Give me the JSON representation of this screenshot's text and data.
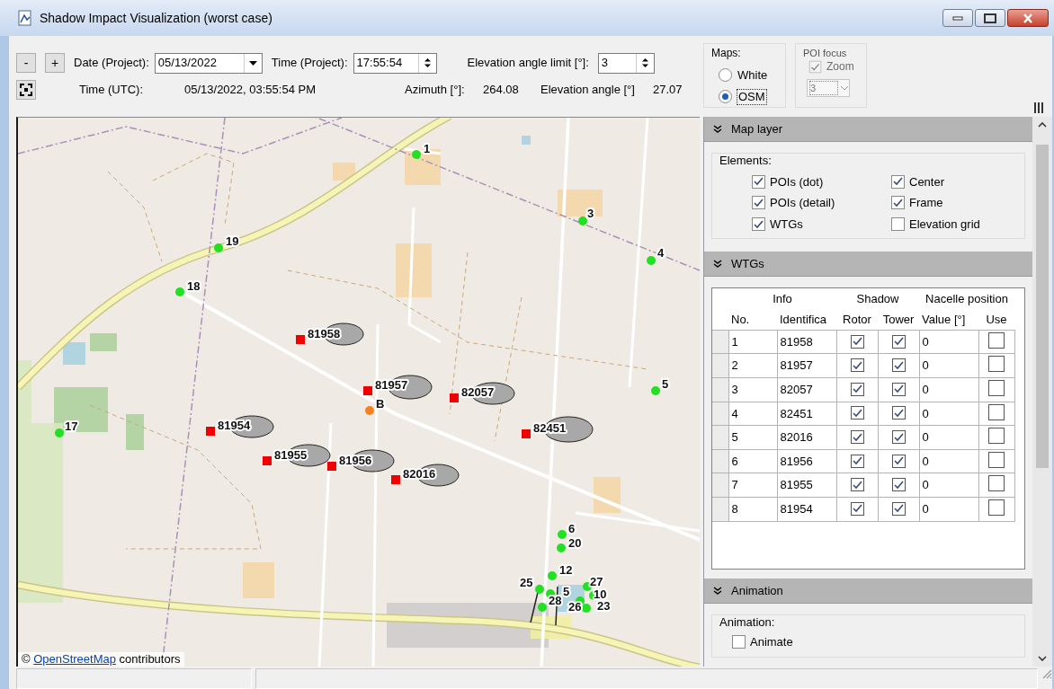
{
  "window": {
    "title": "Shadow Impact Visualization (worst case)"
  },
  "toolbar": {
    "zoom_out": "-",
    "zoom_in": "+",
    "date_label": "Date (Project):",
    "date_value": "05/13/2022",
    "time_label": "Time (Project):",
    "time_value": "17:55:54",
    "elevation_limit_label": "Elevation angle limit [°]:",
    "elevation_limit_value": "3",
    "utc_label": "Time (UTC):",
    "utc_value": "05/13/2022, 03:55:54 PM",
    "azimuth_label": "Azimuth [°]:",
    "azimuth_value": "264.08",
    "elevation_angle_label": "Elevation angle [°]",
    "elevation_angle_value": "27.07",
    "maps": {
      "legend": "Maps:",
      "options": [
        {
          "label": "White",
          "selected": false
        },
        {
          "label": "OSM",
          "selected": true
        }
      ]
    },
    "poi_focus": {
      "legend": "POI focus",
      "zoom": {
        "label": "Zoom",
        "checked": true,
        "disabled": true
      },
      "select_value": "3"
    }
  },
  "map": {
    "pois": [
      {
        "label": "1"
      },
      {
        "label": "3"
      },
      {
        "label": "19"
      },
      {
        "label": "4"
      },
      {
        "label": "18"
      },
      {
        "label": "5"
      },
      {
        "label": "17"
      },
      {
        "label": "6"
      },
      {
        "label": "20"
      },
      {
        "label": "12"
      },
      {
        "label": "25"
      },
      {
        "label": "5"
      },
      {
        "label": "28"
      },
      {
        "label": "26"
      },
      {
        "label": "27"
      },
      {
        "label": "10"
      },
      {
        "label": "23"
      }
    ],
    "turbines": [
      {
        "label": "81958"
      },
      {
        "label": "81957"
      },
      {
        "label": "82057"
      },
      {
        "label": "81954"
      },
      {
        "label": "82451"
      },
      {
        "label": "81955"
      },
      {
        "label": "81956"
      },
      {
        "label": "82016"
      }
    ],
    "center": {
      "label": "B"
    },
    "attribution": {
      "prefix": "©",
      "link": "OpenStreetMap",
      "suffix": "contributors"
    }
  },
  "map_layer": {
    "title": "Map layer",
    "group_label": "Elements:",
    "items": [
      {
        "label": "POIs (dot)",
        "checked": true
      },
      {
        "label": "Center",
        "checked": true
      },
      {
        "label": "POIs (detail)",
        "checked": true
      },
      {
        "label": "Frame",
        "checked": true
      },
      {
        "label": "WTGs",
        "checked": true
      },
      {
        "label": "Elevation grid",
        "checked": false
      }
    ]
  },
  "wtgs": {
    "title": "WTGs",
    "column_groups": [
      "Info",
      "Shadow",
      "Nacelle position"
    ],
    "columns": [
      "No.",
      "Identifica",
      "Rotor",
      "Tower",
      "Value [°]",
      "Use"
    ],
    "rows": [
      {
        "no": "1",
        "id": "81958",
        "rotor": true,
        "tower": true,
        "value": "0",
        "use": false
      },
      {
        "no": "2",
        "id": "81957",
        "rotor": true,
        "tower": true,
        "value": "0",
        "use": false
      },
      {
        "no": "3",
        "id": "82057",
        "rotor": true,
        "tower": true,
        "value": "0",
        "use": false
      },
      {
        "no": "4",
        "id": "82451",
        "rotor": true,
        "tower": true,
        "value": "0",
        "use": false
      },
      {
        "no": "5",
        "id": "82016",
        "rotor": true,
        "tower": true,
        "value": "0",
        "use": false
      },
      {
        "no": "6",
        "id": "81956",
        "rotor": true,
        "tower": true,
        "value": "0",
        "use": false
      },
      {
        "no": "7",
        "id": "81955",
        "rotor": true,
        "tower": true,
        "value": "0",
        "use": false
      },
      {
        "no": "8",
        "id": "81954",
        "rotor": true,
        "tower": true,
        "value": "0",
        "use": false
      }
    ]
  },
  "animation": {
    "title": "Animation",
    "group_label": "Animation:",
    "items": [
      {
        "label": "Animate",
        "checked": false
      }
    ]
  }
}
